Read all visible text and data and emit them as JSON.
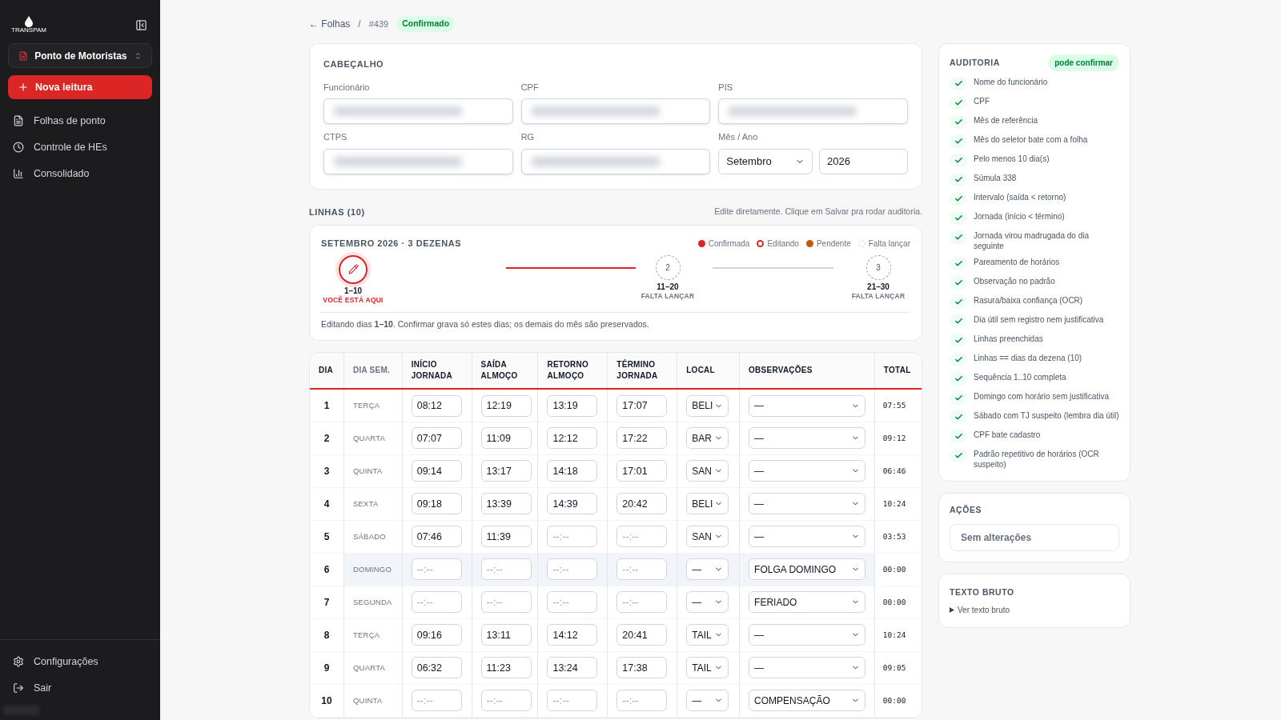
{
  "sidebar": {
    "brand": "TRANSPAM",
    "workspace": "Ponto de Motoristas",
    "new_button": "Nova leitura",
    "items": [
      {
        "label": "Folhas de ponto",
        "kind": "file",
        "selected": false
      },
      {
        "label": "Controle de HEs",
        "kind": "clock",
        "selected": false
      },
      {
        "label": "Consolidado",
        "kind": "chart",
        "selected": false
      }
    ],
    "footer_items": [
      {
        "label": "Configurações",
        "kind": "settings"
      },
      {
        "label": "Sair",
        "kind": "logout"
      }
    ]
  },
  "breadcrumb": {
    "back": "← Folhas",
    "separator": "/",
    "id": "#439",
    "status": "Confirmado"
  },
  "header_card": {
    "title": "CABEÇALHO",
    "fields": [
      {
        "label": "Funcionário",
        "redacted": true
      },
      {
        "label": "CPF",
        "redacted": true
      },
      {
        "label": "PIS",
        "redacted": true
      },
      {
        "label": "CTPS",
        "redacted": true
      },
      {
        "label": "RG",
        "redacted": true
      }
    ],
    "month_label": "Mês / Ano",
    "month": "Setembro",
    "year": "2026"
  },
  "lines": {
    "title": "LINHAS (10)",
    "hint": "Edite diretamente. Clique em Salvar pra rodar auditoria."
  },
  "dezenas": {
    "title": "SETEMBRO 2026 · 3 DEZENAS",
    "legend": [
      {
        "label": "Confirmada",
        "kind": "filled",
        "color": "#dc2626"
      },
      {
        "label": "Editando",
        "kind": "ring",
        "color": "#dc2626"
      },
      {
        "label": "Pendente",
        "kind": "filled",
        "color": "#c2580c"
      },
      {
        "label": "Falta lançar",
        "kind": "dashed",
        "color": "#d4d4d4"
      }
    ],
    "stages": [
      {
        "range": "1–10",
        "caption": "VOCÊ ESTÁ AQUI",
        "current": true
      },
      {
        "number": "2",
        "range": "11–20",
        "caption": "FALTA LANÇAR",
        "current": false
      },
      {
        "number": "3",
        "range": "21–30",
        "caption": "FALTA LANÇAR",
        "current": false
      }
    ],
    "note": "Editando dias **1–10**. Confirmar grava só estes dias; os demais do mês são preservados."
  },
  "table": {
    "columns": [
      "DIA",
      "DIA SEM.",
      "INÍCIO JORNADA",
      "SAÍDA ALMOÇO",
      "RETORNO ALMOÇO",
      "TÉRMINO JORNADA",
      "LOCAL",
      "OBSERVAÇÕES",
      "TOTAL"
    ],
    "rows": [
      {
        "day": "1",
        "weekday": "TERÇA",
        "highlighted": false,
        "times": [
          {
            "value": "08:12"
          },
          {
            "value": "12:19"
          },
          {
            "value": "13:19"
          },
          {
            "value": "17:07"
          }
        ],
        "local": "BELI",
        "obs": "—",
        "total": "07:55"
      },
      {
        "day": "2",
        "weekday": "QUARTA",
        "highlighted": false,
        "times": [
          {
            "value": "07:07"
          },
          {
            "value": "11:09"
          },
          {
            "value": "12:12"
          },
          {
            "value": "17:22"
          }
        ],
        "local": "BAR",
        "obs": "—",
        "total": "09:12"
      },
      {
        "day": "3",
        "weekday": "QUINTA",
        "highlighted": false,
        "times": [
          {
            "value": "09:14"
          },
          {
            "value": "13:17"
          },
          {
            "value": "14:18"
          },
          {
            "value": "17:01"
          }
        ],
        "local": "SAN",
        "obs": "—",
        "total": "06:46"
      },
      {
        "day": "4",
        "weekday": "SEXTA",
        "highlighted": false,
        "times": [
          {
            "value": "09:18"
          },
          {
            "value": "13:39"
          },
          {
            "value": "14:39"
          },
          {
            "value": "20:42"
          }
        ],
        "local": "BELI",
        "obs": "—",
        "total": "10:24"
      },
      {
        "day": "5",
        "weekday": "SÁBADO",
        "highlighted": false,
        "times": [
          {
            "value": "07:46"
          },
          {
            "value": "11:39"
          },
          {
            "placeholder": "--:--"
          },
          {
            "placeholder": "--:--"
          }
        ],
        "local": "SAN",
        "obs": "—",
        "total": "03:53"
      },
      {
        "day": "6",
        "weekday": "DOMINGO",
        "highlighted": true,
        "times": [
          {
            "placeholder": "--:--"
          },
          {
            "placeholder": "--:--"
          },
          {
            "placeholder": "--:--"
          },
          {
            "placeholder": "--:--"
          }
        ],
        "local": "—",
        "obs": "FOLGA DOMINGO",
        "total": "00:00"
      },
      {
        "day": "7",
        "weekday": "SEGUNDA",
        "highlighted": false,
        "times": [
          {
            "placeholder": "--:--"
          },
          {
            "placeholder": "--:--"
          },
          {
            "placeholder": "--:--"
          },
          {
            "placeholder": "--:--"
          }
        ],
        "local": "—",
        "obs": "FERIADO",
        "total": "00:00"
      },
      {
        "day": "8",
        "weekday": "TERÇA",
        "highlighted": false,
        "times": [
          {
            "value": "09:16"
          },
          {
            "value": "13:11"
          },
          {
            "value": "14:12"
          },
          {
            "value": "20:41"
          }
        ],
        "local": "TAIL",
        "obs": "—",
        "total": "10:24"
      },
      {
        "day": "9",
        "weekday": "QUARTA",
        "highlighted": false,
        "times": [
          {
            "value": "06:32"
          },
          {
            "value": "11:23"
          },
          {
            "value": "13:24"
          },
          {
            "value": "17:38"
          }
        ],
        "local": "TAIL",
        "obs": "—",
        "total": "09:05"
      },
      {
        "day": "10",
        "weekday": "QUINTA",
        "highlighted": false,
        "times": [
          {
            "placeholder": "--:--"
          },
          {
            "placeholder": "--:--"
          },
          {
            "placeholder": "--:--"
          },
          {
            "placeholder": "--:--"
          }
        ],
        "local": "—",
        "obs": "COMPENSAÇÃO",
        "total": "00:00"
      }
    ]
  },
  "audit": {
    "title": "AUDITORIA",
    "badge": "pode confirmar",
    "checks": [
      {
        "label": "Nome do funcionário",
        "passed": true
      },
      {
        "label": "CPF",
        "passed": true
      },
      {
        "label": "Mês de referência",
        "passed": true
      },
      {
        "label": "Mês do seletor bate com a folha",
        "passed": true
      },
      {
        "label": "Pelo menos 10 dia(s)",
        "passed": true
      },
      {
        "label": "Súmula 338",
        "passed": true
      },
      {
        "label": "Intervalo (saída < retorno)",
        "passed": true
      },
      {
        "label": "Jornada (início < término)",
        "passed": true
      },
      {
        "label": "Jornada virou madrugada do dia seguinte",
        "passed": true
      },
      {
        "label": "Pareamento de horários",
        "passed": true
      },
      {
        "label": "Observação no padrão",
        "passed": true
      },
      {
        "label": "Rasura/baixa confiança (OCR)",
        "passed": true
      },
      {
        "label": "Dia útil sem registro nem justificativa",
        "passed": true
      },
      {
        "label": "Linhas preenchidas",
        "passed": true
      },
      {
        "label": "Linhas == dias da dezena (10)",
        "passed": true
      },
      {
        "label": "Sequência 1..10 completa",
        "passed": true
      },
      {
        "label": "Domingo com horário sem justificativa",
        "passed": true
      },
      {
        "label": "Sábado com TJ suspeito (lembra dia útil)",
        "passed": true
      },
      {
        "label": "CPF bate cadastro",
        "passed": true
      },
      {
        "label": "Padrão repetitivo de horários (OCR suspeito)",
        "passed": true
      }
    ]
  },
  "actions": {
    "title": "AÇÕES",
    "status": "Sem alterações"
  },
  "raw_text": {
    "title": "TEXTO BRUTO",
    "toggle": "Ver texto bruto",
    "expanded": false
  }
}
